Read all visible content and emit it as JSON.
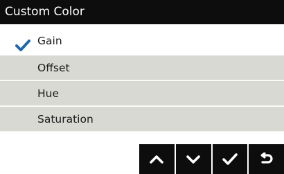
{
  "header": {
    "title": "Custom Color"
  },
  "menu": {
    "items": [
      {
        "label": "Gain",
        "selected": true
      },
      {
        "label": "Offset",
        "selected": false
      },
      {
        "label": "Hue",
        "selected": false
      },
      {
        "label": "Saturation",
        "selected": false
      }
    ]
  },
  "footer": {
    "buttons": [
      {
        "icon": "chevron-up-icon"
      },
      {
        "icon": "chevron-down-icon"
      },
      {
        "icon": "check-icon"
      },
      {
        "icon": "return-icon"
      }
    ]
  },
  "colors": {
    "header_bg": "#0d0d0d",
    "accent": "#1f66b3",
    "item_bg": "#d9d9d4",
    "button_bg": "#0d0d0d"
  }
}
